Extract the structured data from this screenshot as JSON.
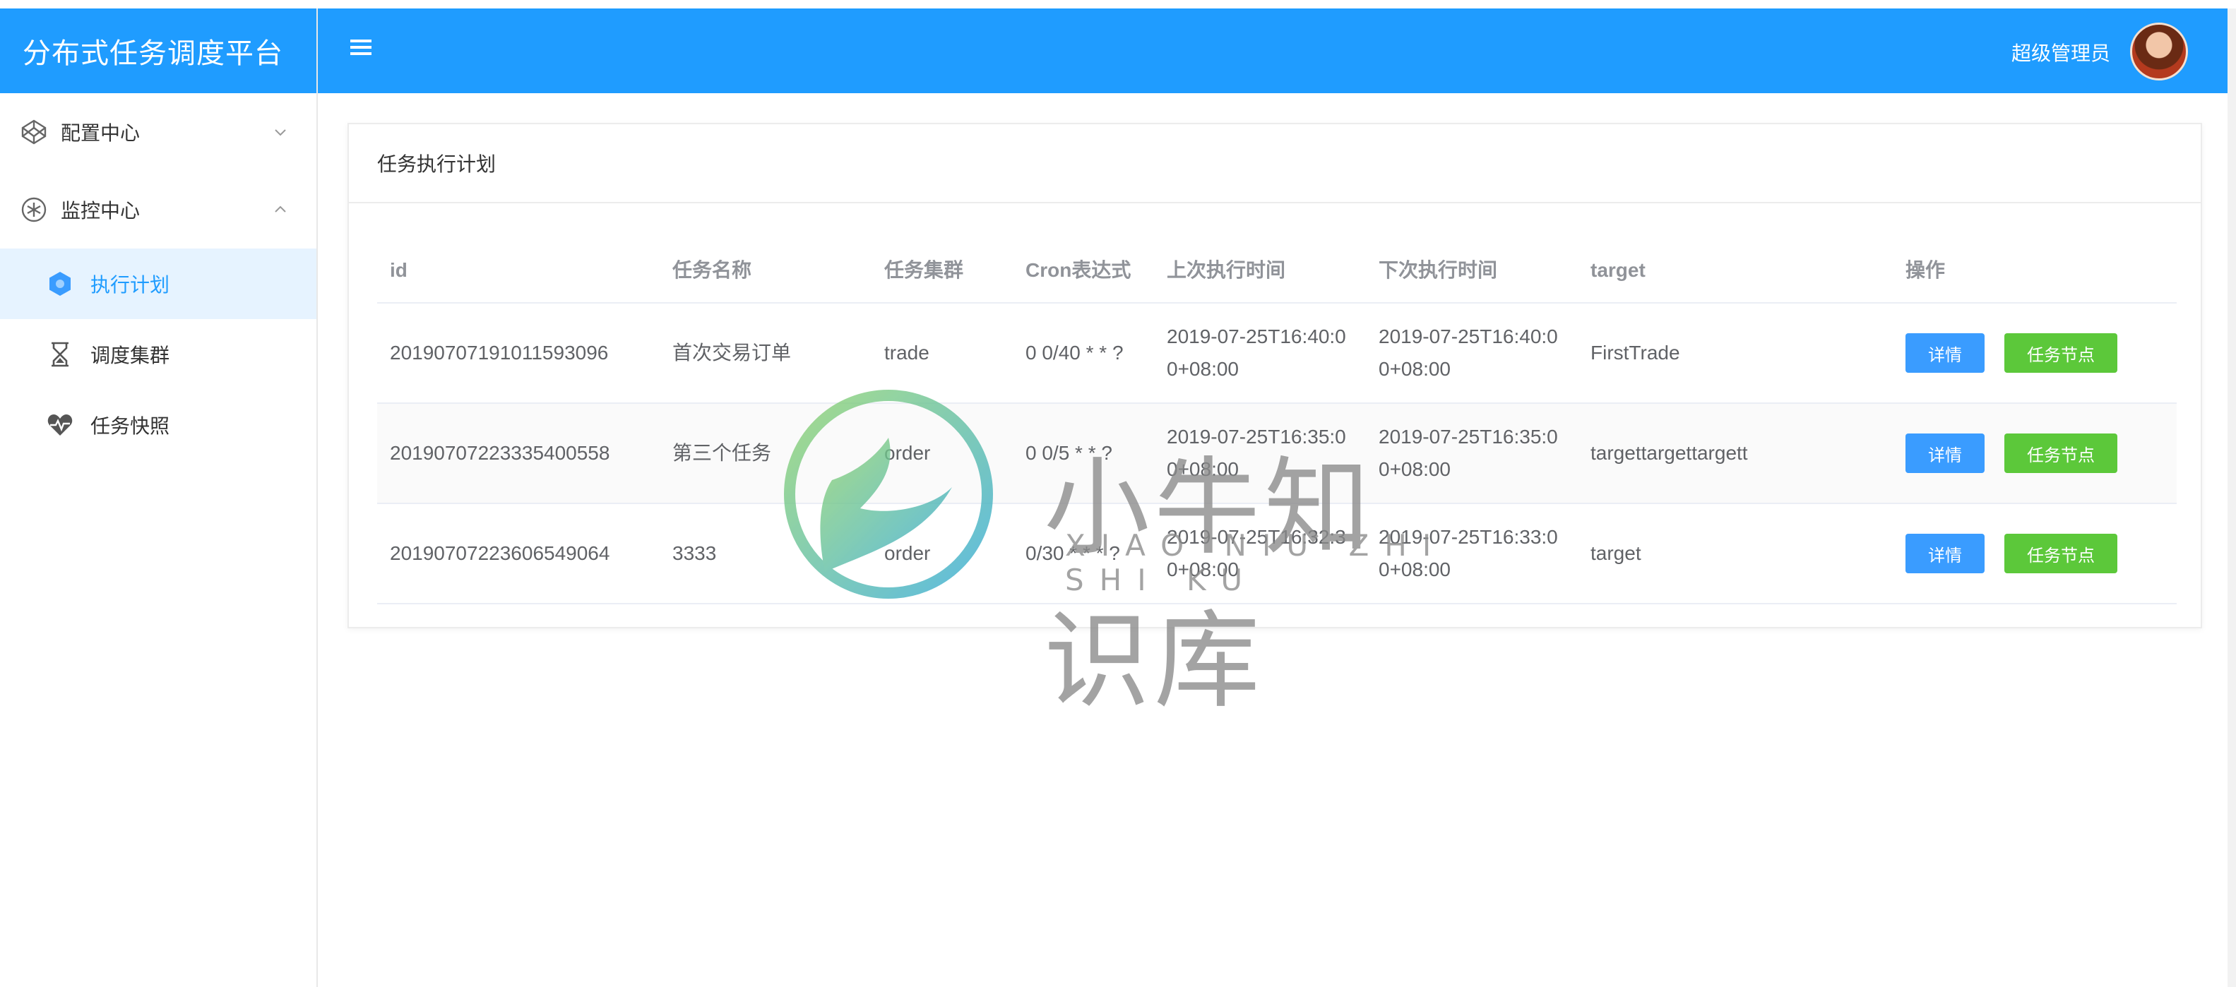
{
  "app": {
    "title": "分布式任务调度平台"
  },
  "sidebar": {
    "groups": [
      {
        "label": "配置中心",
        "icon": "codepen-icon",
        "expanded": false
      },
      {
        "label": "监控中心",
        "icon": "monitor-icon",
        "expanded": true
      }
    ],
    "items": [
      {
        "label": "执行计划",
        "icon": "hexagon-icon",
        "active": true
      },
      {
        "label": "调度集群",
        "icon": "hourglass-icon",
        "active": false
      },
      {
        "label": "任务快照",
        "icon": "heartbeat-icon",
        "active": false
      }
    ]
  },
  "header": {
    "menu_icon": "hamburger-icon",
    "user_name": "超级管理员"
  },
  "card": {
    "title": "任务执行计划"
  },
  "table": {
    "columns": [
      "id",
      "任务名称",
      "任务集群",
      "Cron表达式",
      "上次执行时间",
      "下次执行时间",
      "target",
      "操作"
    ],
    "rows": [
      {
        "id": "20190707191011593096",
        "name": "首次交易订单",
        "cluster": "trade",
        "cron": "0 0/40 * * ?",
        "last": "2019-07-25T16:40:00+08:00",
        "next": "2019-07-25T16:40:00+08:00",
        "target": "FirstTrade"
      },
      {
        "id": "20190707223335400558",
        "name": "第三个任务",
        "cluster": "order",
        "cron": "0 0/5 * * ?",
        "last": "2019-07-25T16:35:00+08:00",
        "next": "2019-07-25T16:35:00+08:00",
        "target": "targettargettargett"
      },
      {
        "id": "20190707223606549064",
        "name": "3333",
        "cluster": "order",
        "cron": "0/30 * * * ?",
        "last": "2019-07-25T16:32:30+08:00",
        "next": "2019-07-25T16:33:00+08:00",
        "target": "target"
      }
    ],
    "actions": {
      "detail": "详情",
      "nodes": "任务节点"
    }
  },
  "watermark": {
    "text": "小牛知识库",
    "subtext": "XIAO NIU ZHI SHI KU"
  },
  "colors": {
    "primary": "#1f9cff",
    "success": "#5cc83a",
    "detail": "#3a9cff",
    "active_bg": "#e6f3ff"
  }
}
